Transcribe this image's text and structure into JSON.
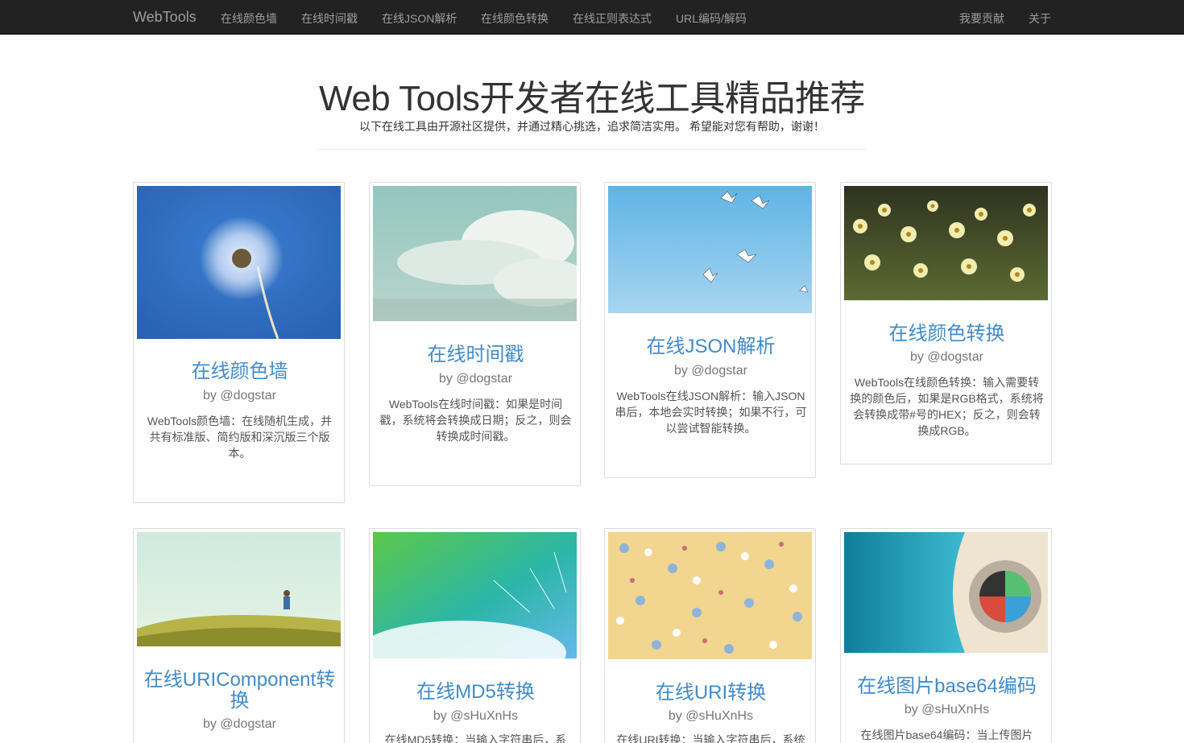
{
  "nav": {
    "brand": "WebTools",
    "links": [
      "在线颜色墙",
      "在线时间戳",
      "在线JSON解析",
      "在线颜色转换",
      "在线正则表达式",
      "URL编码/解码"
    ],
    "right": [
      "我要贡献",
      "关于"
    ]
  },
  "hero": {
    "title": "Web Tools开发者在线工具精品推荐",
    "subtitle": "以下在线工具由开源社区提供，并通过精心挑选，追求简洁实用。 希望能对您有帮助，谢谢！"
  },
  "cards": [
    {
      "title": "在线颜色墙",
      "author": "by @dogstar",
      "desc": "WebTools颜色墙：在线随机生成，并共有标准版、简约版和深沉版三个版本。",
      "image": "dandelion"
    },
    {
      "title": "在线时间戳",
      "author": "by @dogstar",
      "desc": "WebTools在线时间戳：如果是时间戳，系统将会转换成日期；反之，则会转换成时间戳。",
      "image": "clouds"
    },
    {
      "title": "在线JSON解析",
      "author": "by @dogstar",
      "desc": "WebTools在线JSON解析：输入JSON串后，本地会实时转换；如果不行，可以尝试智能转换。",
      "image": "seagulls"
    },
    {
      "title": "在线颜色转换",
      "author": "by @dogstar",
      "desc": "WebTools在线颜色转换：输入需要转换的颜色后，如果是RGB格式，系统将会转换成带#号的HEX；反之，则会转换成RGB。",
      "image": "daisies"
    },
    {
      "title": "在线URIComponent转换",
      "author": "by @dogstar",
      "desc": "",
      "image": "meadow"
    },
    {
      "title": "在线MD5转换",
      "author": "by @sHuXnHs",
      "desc": "在线MD5转换：当输入字符串后，系",
      "image": "dandelion-seeds"
    },
    {
      "title": "在线URI转换",
      "author": "by @sHuXnHs",
      "desc": "在线URI转换：当输入字符串后，系统",
      "image": "floral-pattern"
    },
    {
      "title": "在线图片base64编码",
      "author": "by @sHuXnHs",
      "desc": "在线图片base64编码：当上传图片",
      "image": "beach-umbrella"
    }
  ]
}
